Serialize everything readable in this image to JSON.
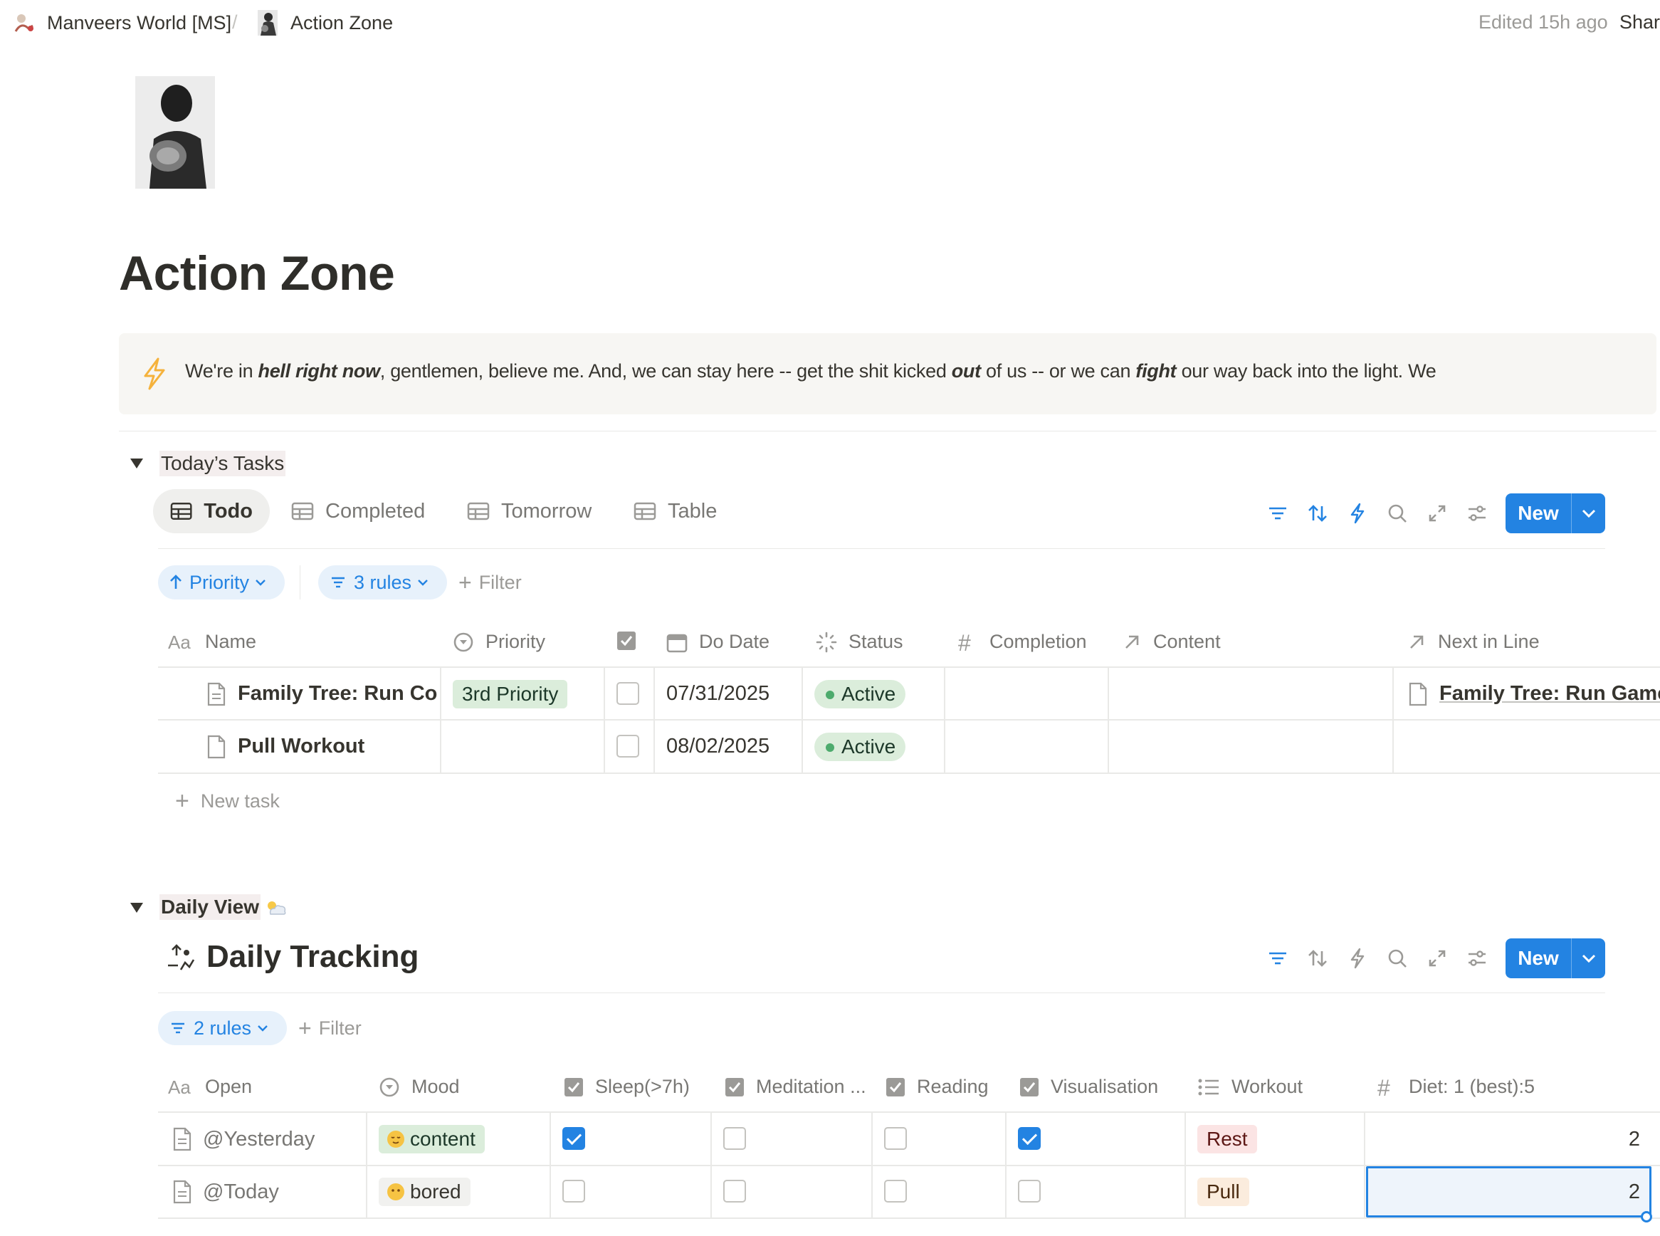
{
  "topbar": {
    "workspace": "Manveers World [MS]",
    "separator": "/",
    "page": "Action Zone",
    "edited": "Edited 15h ago",
    "share": "Share"
  },
  "page": {
    "title": "Action Zone",
    "callout": {
      "icon": "lightning-icon",
      "parts": [
        "We're in ",
        "hell right now",
        ", gentlemen, believe me. And, we can stay here -- get the shit kicked ",
        "out",
        " of us -- or we can ",
        "fight",
        " our way back into the light. We"
      ]
    }
  },
  "tasks": {
    "toggle_label": "Today’s Tasks",
    "tabs": [
      "Todo",
      "Completed",
      "Tomorrow",
      "Table"
    ],
    "new_label": "New",
    "sort_chip": "Priority",
    "filter_chip": "3 rules",
    "add_filter": "Filter",
    "columns": [
      "Name",
      "Priority",
      "Do Date",
      "Status",
      "Completion",
      "Content",
      "Next in Line"
    ],
    "rows": [
      {
        "name": "Family Tree: Run Cod",
        "priority": "3rd Priority",
        "date": "07/31/2025",
        "status": "Active",
        "next": "Family Tree: Run Game",
        "done": false
      },
      {
        "name": "Pull Workout",
        "priority": "",
        "date": "08/02/2025",
        "status": "Active",
        "next": "",
        "done": false
      }
    ],
    "new_row": "New task",
    "colors": {
      "priority_bg": "#dbeddb",
      "priority_fg": "#1c3829",
      "status_dot": "#4dab6d"
    }
  },
  "daily": {
    "toggle_label": "Daily View",
    "toggle_emoji": "sun-cloud-icon",
    "title": "Daily Tracking",
    "new_label": "New",
    "filter_chip": "2 rules",
    "add_filter": "Filter",
    "columns": [
      "Open",
      "Mood",
      "Sleep(>7h)",
      "Meditation ...",
      "Reading",
      "Visualisation",
      "Workout",
      "Diet: 1 (best):5"
    ],
    "rows": [
      {
        "open": "@Yesterday",
        "mood": "content",
        "sleep": true,
        "meditation": false,
        "reading": false,
        "visualisation": true,
        "workout": "Rest",
        "diet": "2"
      },
      {
        "open": "@Today",
        "mood": "bored",
        "sleep": false,
        "meditation": false,
        "reading": false,
        "visualisation": false,
        "workout": "Pull",
        "diet": "2"
      }
    ],
    "colors": {
      "rest_bg": "#fbe4e4",
      "rest_fg": "#5d1715",
      "pull_bg": "#fbecdd",
      "pull_fg": "#49290e",
      "mood_bg": "#dbeddb"
    }
  },
  "accent": "#2383e2"
}
